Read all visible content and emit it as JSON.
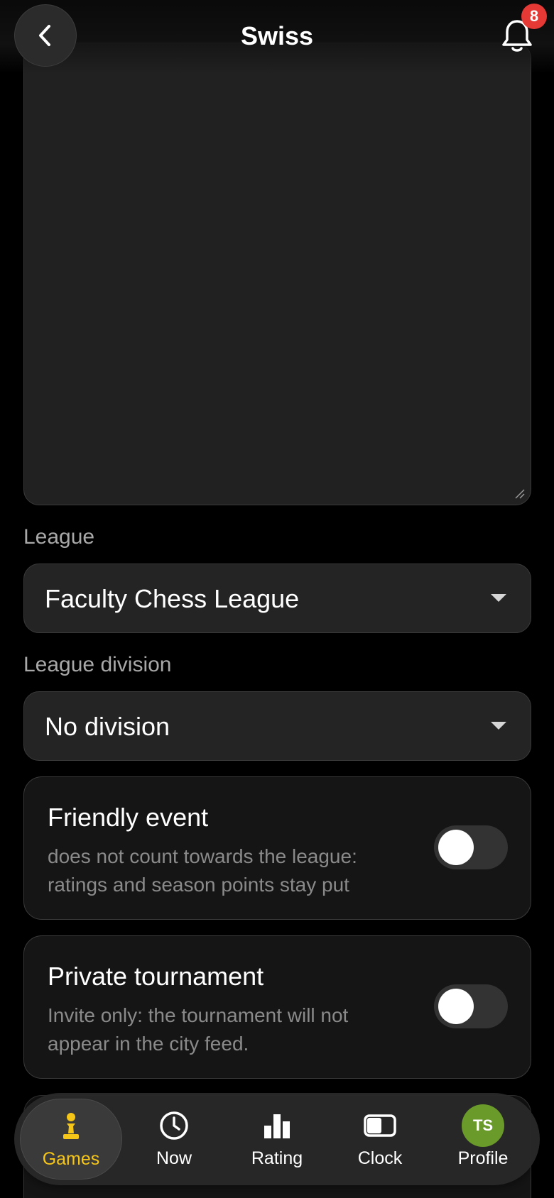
{
  "header": {
    "title": "Swiss",
    "notifications_count": "8"
  },
  "league": {
    "label": "League",
    "value": "Faculty Chess League"
  },
  "division": {
    "label": "League division",
    "value": "No division"
  },
  "friendly": {
    "title": "Friendly event",
    "description": "does not count towards the league: ratings and season points stay put",
    "enabled": false
  },
  "private": {
    "title": "Private tournament",
    "description": "Invite only: the tournament will not appear in the city feed.",
    "enabled": false
  },
  "tabs": [
    {
      "label": "Games",
      "icon": "pawn-icon",
      "active": true
    },
    {
      "label": "Now",
      "icon": "clock-icon",
      "active": false
    },
    {
      "label": "Rating",
      "icon": "bar-chart-icon",
      "active": false
    },
    {
      "label": "Clock",
      "icon": "chess-clock-icon",
      "active": false
    },
    {
      "label": "Profile",
      "icon": "avatar",
      "active": false,
      "initials": "TS"
    }
  ],
  "colors": {
    "accent": "#f5c518",
    "badge": "#e53935",
    "avatar": "#6a9a2a"
  }
}
